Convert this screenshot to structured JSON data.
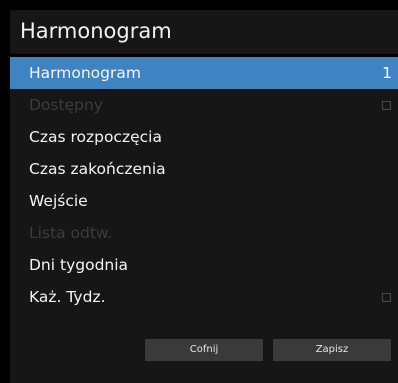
{
  "dialog": {
    "title": "Harmonogram"
  },
  "menu": {
    "items": [
      {
        "label": "Harmonogram",
        "value": "1",
        "state": "selected"
      },
      {
        "label": "Dostępny",
        "state": "disabled",
        "checkbox": "unchecked"
      },
      {
        "label": "Czas rozpoczęcia",
        "state": "enabled"
      },
      {
        "label": "Czas zakończenia",
        "state": "enabled"
      },
      {
        "label": "Wejście",
        "state": "enabled"
      },
      {
        "label": "Lista odtw.",
        "state": "disabled"
      },
      {
        "label": "Dni tygodnia",
        "state": "enabled"
      },
      {
        "label": "Każ. Tydz.",
        "state": "enabled",
        "checkbox": "unchecked"
      }
    ]
  },
  "buttons": {
    "back_label": "Cofnij",
    "save_label": "Zapisz"
  },
  "colors": {
    "selection": "#3f83c2",
    "panel": "#161616",
    "background": "#000000",
    "button": "#3a3a3a",
    "text": "#f4f4f4",
    "disabled_text": "#3c3c3c"
  }
}
